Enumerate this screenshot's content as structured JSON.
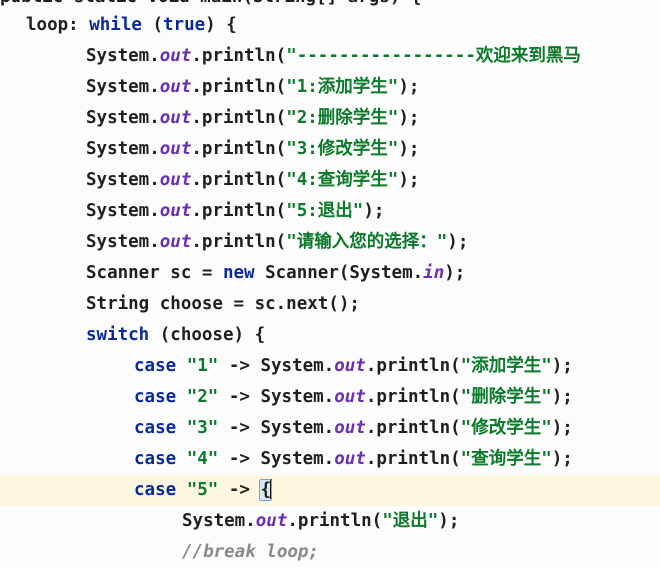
{
  "editor": {
    "lines": [
      {
        "tokens": [
          {
            "t": "public static void main(String[] args) {",
            "c": "plain"
          }
        ]
      },
      {
        "tokens": [
          {
            "t": "loop",
            "c": "label"
          },
          {
            "t": ": ",
            "c": "plain"
          },
          {
            "t": "while",
            "c": "kw"
          },
          {
            "t": " (",
            "c": "plain"
          },
          {
            "t": "true",
            "c": "kw"
          },
          {
            "t": ") {",
            "c": "plain"
          }
        ]
      },
      {
        "tokens": [
          {
            "t": "System.",
            "c": "plain"
          },
          {
            "t": "out",
            "c": "field"
          },
          {
            "t": ".println(",
            "c": "plain"
          },
          {
            "t": "\"-----------------欢迎来到黑马",
            "c": "str"
          }
        ]
      },
      {
        "tokens": [
          {
            "t": "System.",
            "c": "plain"
          },
          {
            "t": "out",
            "c": "field"
          },
          {
            "t": ".println(",
            "c": "plain"
          },
          {
            "t": "\"1:添加学生\"",
            "c": "str"
          },
          {
            "t": ");",
            "c": "plain"
          }
        ]
      },
      {
        "tokens": [
          {
            "t": "System.",
            "c": "plain"
          },
          {
            "t": "out",
            "c": "field"
          },
          {
            "t": ".println(",
            "c": "plain"
          },
          {
            "t": "\"2:删除学生\"",
            "c": "str"
          },
          {
            "t": ");",
            "c": "plain"
          }
        ]
      },
      {
        "tokens": [
          {
            "t": "System.",
            "c": "plain"
          },
          {
            "t": "out",
            "c": "field"
          },
          {
            "t": ".println(",
            "c": "plain"
          },
          {
            "t": "\"3:修改学生\"",
            "c": "str"
          },
          {
            "t": ");",
            "c": "plain"
          }
        ]
      },
      {
        "tokens": [
          {
            "t": "System.",
            "c": "plain"
          },
          {
            "t": "out",
            "c": "field"
          },
          {
            "t": ".println(",
            "c": "plain"
          },
          {
            "t": "\"4:查询学生\"",
            "c": "str"
          },
          {
            "t": ");",
            "c": "plain"
          }
        ]
      },
      {
        "tokens": [
          {
            "t": "System.",
            "c": "plain"
          },
          {
            "t": "out",
            "c": "field"
          },
          {
            "t": ".println(",
            "c": "plain"
          },
          {
            "t": "\"5:退出\"",
            "c": "str"
          },
          {
            "t": ");",
            "c": "plain"
          }
        ]
      },
      {
        "tokens": [
          {
            "t": "System.",
            "c": "plain"
          },
          {
            "t": "out",
            "c": "field"
          },
          {
            "t": ".println(",
            "c": "plain"
          },
          {
            "t": "\"请输入您的选择：\"",
            "c": "str"
          },
          {
            "t": ");",
            "c": "plain"
          }
        ]
      },
      {
        "tokens": [
          {
            "t": "Scanner sc = ",
            "c": "plain"
          },
          {
            "t": "new",
            "c": "kw"
          },
          {
            "t": " Scanner(System.",
            "c": "plain"
          },
          {
            "t": "in",
            "c": "field"
          },
          {
            "t": ");",
            "c": "plain"
          }
        ]
      },
      {
        "tokens": [
          {
            "t": "String choose = sc.next();",
            "c": "plain"
          }
        ]
      },
      {
        "tokens": [
          {
            "t": "switch",
            "c": "kw"
          },
          {
            "t": " (choose) {",
            "c": "plain"
          }
        ]
      },
      {
        "tokens": [
          {
            "t": "case",
            "c": "kw"
          },
          {
            "t": " ",
            "c": "plain"
          },
          {
            "t": "\"1\"",
            "c": "str"
          },
          {
            "t": " -> System.",
            "c": "plain"
          },
          {
            "t": "out",
            "c": "field"
          },
          {
            "t": ".println(",
            "c": "plain"
          },
          {
            "t": "\"添加学生\"",
            "c": "str"
          },
          {
            "t": ");",
            "c": "plain"
          }
        ]
      },
      {
        "tokens": [
          {
            "t": "case",
            "c": "kw"
          },
          {
            "t": " ",
            "c": "plain"
          },
          {
            "t": "\"2\"",
            "c": "str"
          },
          {
            "t": " -> System.",
            "c": "plain"
          },
          {
            "t": "out",
            "c": "field"
          },
          {
            "t": ".println(",
            "c": "plain"
          },
          {
            "t": "\"删除学生\"",
            "c": "str"
          },
          {
            "t": ");",
            "c": "plain"
          }
        ]
      },
      {
        "tokens": [
          {
            "t": "case",
            "c": "kw"
          },
          {
            "t": " ",
            "c": "plain"
          },
          {
            "t": "\"3\"",
            "c": "str"
          },
          {
            "t": " -> System.",
            "c": "plain"
          },
          {
            "t": "out",
            "c": "field"
          },
          {
            "t": ".println(",
            "c": "plain"
          },
          {
            "t": "\"修改学生\"",
            "c": "str"
          },
          {
            "t": ");",
            "c": "plain"
          }
        ]
      },
      {
        "tokens": [
          {
            "t": "case",
            "c": "kw"
          },
          {
            "t": " ",
            "c": "plain"
          },
          {
            "t": "\"4\"",
            "c": "str"
          },
          {
            "t": " -> System.",
            "c": "plain"
          },
          {
            "t": "out",
            "c": "field"
          },
          {
            "t": ".println(",
            "c": "plain"
          },
          {
            "t": "\"查询学生\"",
            "c": "str"
          },
          {
            "t": ");",
            "c": "plain"
          }
        ]
      },
      {
        "tokens": [
          {
            "t": "case",
            "c": "kw"
          },
          {
            "t": " ",
            "c": "plain"
          },
          {
            "t": "\"5\"",
            "c": "str"
          },
          {
            "t": " -> ",
            "c": "plain"
          },
          {
            "t": "{",
            "c": "brace"
          }
        ]
      },
      {
        "tokens": [
          {
            "t": "System.",
            "c": "plain"
          },
          {
            "t": "out",
            "c": "field"
          },
          {
            "t": ".println(",
            "c": "plain"
          },
          {
            "t": "\"退出\"",
            "c": "str"
          },
          {
            "t": ");",
            "c": "plain"
          }
        ]
      },
      {
        "tokens": [
          {
            "t": "//break loop;",
            "c": "cmt"
          }
        ]
      }
    ]
  }
}
